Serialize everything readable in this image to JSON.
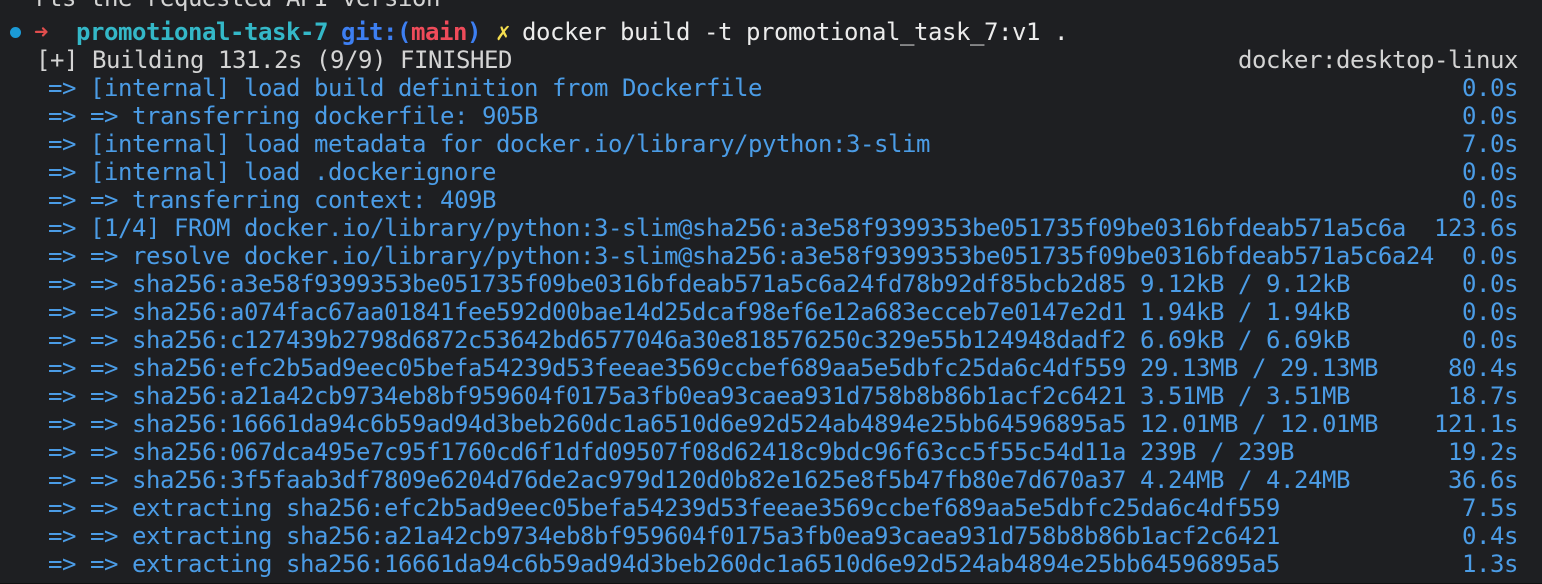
{
  "terminal": {
    "top_fragment": "rts the requested API version",
    "prompt": {
      "arrow": "➜",
      "directory": "promotional-task-7",
      "git_label": "git:",
      "branch_open": "(",
      "branch": "main",
      "branch_close": ")",
      "dirty_mark": "✗",
      "command": "docker build -t promotional_task_7:v1 ."
    },
    "build_header": {
      "left": "[+] Building 131.2s (9/9) FINISHED",
      "right": "docker:desktop-linux"
    },
    "lines": [
      {
        "text": "=> [internal] load build definition from Dockerfile",
        "progress": "",
        "time": "0.0s"
      },
      {
        "text": "=> => transferring dockerfile: 905B",
        "progress": "",
        "time": "0.0s"
      },
      {
        "text": "=> [internal] load metadata for docker.io/library/python:3-slim",
        "progress": "",
        "time": "7.0s"
      },
      {
        "text": "=> [internal] load .dockerignore",
        "progress": "",
        "time": "0.0s"
      },
      {
        "text": "=> => transferring context: 409B",
        "progress": "",
        "time": "0.0s"
      },
      {
        "text": "=> [1/4] FROM docker.io/library/python:3-slim@sha256:a3e58f9399353be051735f09be0316bfdeab571a5c6a",
        "progress": "",
        "time": "123.6s"
      },
      {
        "text": "=> => resolve docker.io/library/python:3-slim@sha256:a3e58f9399353be051735f09be0316bfdeab571a5c6a24",
        "progress": "",
        "time": "0.0s"
      },
      {
        "text": "=> => sha256:a3e58f9399353be051735f09be0316bfdeab571a5c6a24fd78b92df85bcb2d85",
        "progress": "9.12kB / 9.12kB",
        "time": "0.0s"
      },
      {
        "text": "=> => sha256:a074fac67aa01841fee592d00bae14d25dcaf98ef6e12a683ecceb7e0147e2d1",
        "progress": "1.94kB / 1.94kB",
        "time": "0.0s"
      },
      {
        "text": "=> => sha256:c127439b2798d6872c53642bd6577046a30e818576250c329e55b124948dadf2",
        "progress": "6.69kB / 6.69kB",
        "time": "0.0s"
      },
      {
        "text": "=> => sha256:efc2b5ad9eec05befa54239d53feeae3569ccbef689aa5e5dbfc25da6c4df559",
        "progress": "29.13MB / 29.13MB",
        "time": "80.4s"
      },
      {
        "text": "=> => sha256:a21a42cb9734eb8bf959604f0175a3fb0ea93caea931d758b8b86b1acf2c6421",
        "progress": "3.51MB / 3.51MB",
        "time": "18.7s"
      },
      {
        "text": "=> => sha256:16661da94c6b59ad94d3beb260dc1a6510d6e92d524ab4894e25bb64596895a5",
        "progress": "12.01MB / 12.01MB",
        "time": "121.1s"
      },
      {
        "text": "=> => sha256:067dca495e7c95f1760cd6f1dfd09507f08d62418c9bdc96f63cc5f55c54d11a",
        "progress": "239B / 239B",
        "time": "19.2s"
      },
      {
        "text": "=> => sha256:3f5faab3df7809e6204d76de2ac979d120d0b82e1625e8f5b47fb80e7d670a37",
        "progress": "4.24MB / 4.24MB",
        "time": "36.6s"
      },
      {
        "text": "=> => extracting sha256:efc2b5ad9eec05befa54239d53feeae3569ccbef689aa5e5dbfc25da6c4df559",
        "progress": "",
        "time": "7.5s"
      },
      {
        "text": "=> => extracting sha256:a21a42cb9734eb8bf959604f0175a3fb0ea93caea931d758b8b86b1acf2c6421",
        "progress": "",
        "time": "0.4s"
      },
      {
        "text": "=> => extracting sha256:16661da94c6b59ad94d3beb260dc1a6510d6e92d524ab4894e25bb64596895a5",
        "progress": "",
        "time": "1.3s"
      }
    ]
  }
}
